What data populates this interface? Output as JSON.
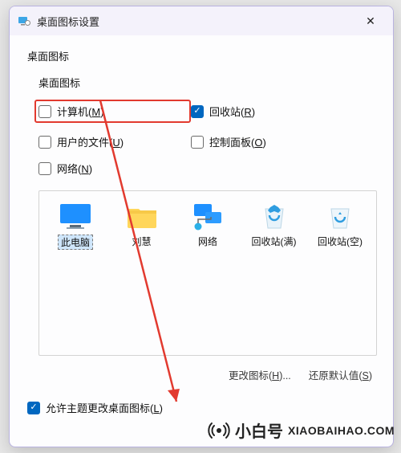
{
  "window": {
    "title": "桌面图标设置"
  },
  "section_label": "桌面图标",
  "group_label": "桌面图标",
  "checks": {
    "computer": {
      "label": "计算机",
      "accel": "M",
      "checked": false
    },
    "recyclebin": {
      "label": "回收站",
      "accel": "R",
      "checked": true
    },
    "userfiles": {
      "label": "用户的文件",
      "accel": "U",
      "checked": false
    },
    "controlpanel": {
      "label": "控制面板",
      "accel": "O",
      "checked": false
    },
    "network": {
      "label": "网络",
      "accel": "N",
      "checked": false
    }
  },
  "icons": [
    {
      "name": "此电脑",
      "kind": "pc",
      "selected": true
    },
    {
      "name": "刘慧",
      "kind": "folder",
      "selected": false
    },
    {
      "name": "网络",
      "kind": "network",
      "selected": false
    },
    {
      "name": "回收站(满)",
      "kind": "bin-full",
      "selected": false
    },
    {
      "name": "回收站(空)",
      "kind": "bin-empty",
      "selected": false
    }
  ],
  "buttons": {
    "change_icon": {
      "label": "更改图标",
      "accel": "H"
    },
    "restore_defaults": {
      "label": "还原默认值",
      "accel": "S"
    }
  },
  "theme_allow": {
    "label": "允许主题更改桌面图标",
    "accel": "L",
    "checked": true
  },
  "watermark": {
    "cn": "小白号",
    "en": "XIAOBAIHAO.COM",
    "tag": "@ 小白号"
  }
}
